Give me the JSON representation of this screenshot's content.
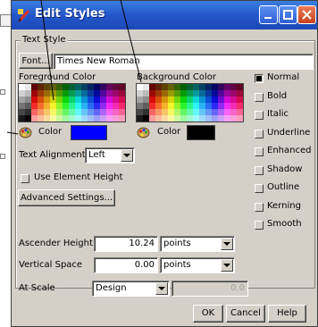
{
  "window": {
    "title": "Edit Styles"
  },
  "text_style": {
    "group_label": "Text Style",
    "font_button": "Font...",
    "font_value": "Times New Roman",
    "foreground_label": "Foreground Color",
    "background_label": "Background Color",
    "fg_color_label": "Color",
    "bg_color_label": "Color",
    "fg_color": "#0000ff",
    "bg_color": "#000000",
    "alignment_label": "Text Alignment",
    "alignment_value": "Left",
    "use_element_height": "Use Element Height",
    "advanced_button": "Advanced Settings..."
  },
  "styles": [
    {
      "label": "Normal",
      "checked": true
    },
    {
      "label": "Bold",
      "checked": false
    },
    {
      "label": "Italic",
      "checked": false
    },
    {
      "label": "Underline",
      "checked": false
    },
    {
      "label": "Enhanced",
      "checked": false
    },
    {
      "label": "Shadow",
      "checked": false
    },
    {
      "label": "Outline",
      "checked": false
    },
    {
      "label": "Kerning",
      "checked": false
    },
    {
      "label": "Smooth",
      "checked": false
    }
  ],
  "ascender": {
    "label": "Ascender Height",
    "value": "10.24",
    "unit": "points"
  },
  "vertical_space": {
    "label": "Vertical Space",
    "value": "0.00",
    "unit": "points"
  },
  "scale": {
    "label": "At Scale",
    "value": "Design",
    "disabled_value": "0.0"
  },
  "buttons": {
    "ok": "OK",
    "cancel": "Cancel",
    "help": "Help"
  },
  "colors": {
    "title_bar": "#2456c9",
    "dialog_bg": "#d4d0c8"
  }
}
